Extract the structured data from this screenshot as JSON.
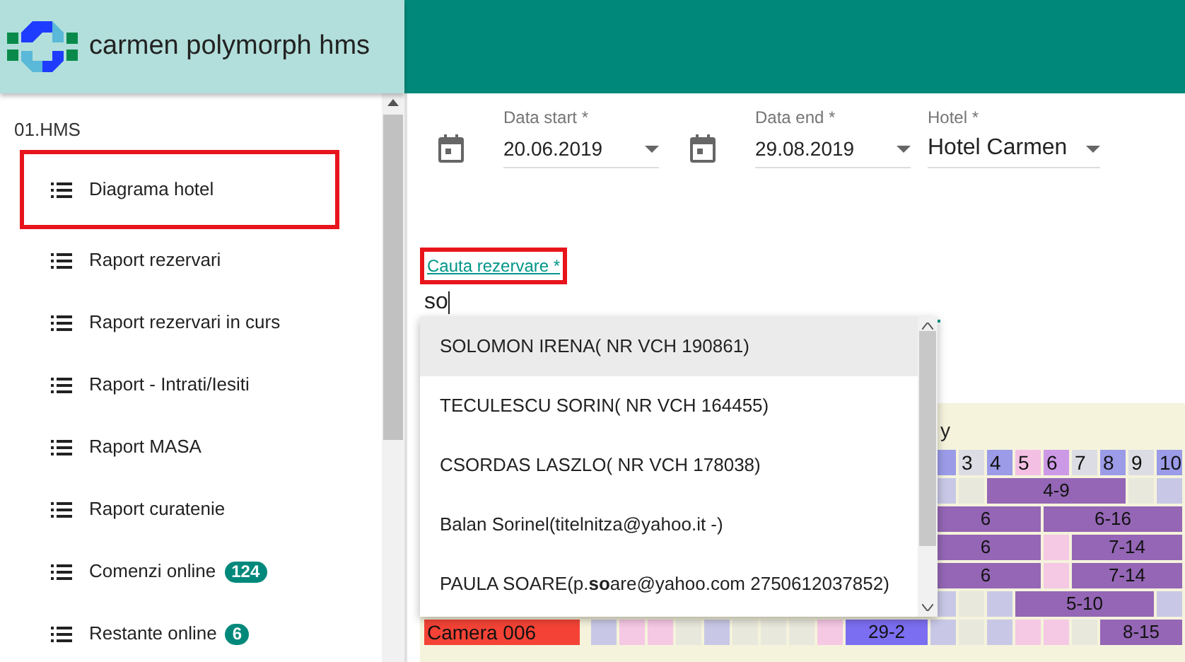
{
  "app": {
    "title": "carmen polymorph hms"
  },
  "sidebar": {
    "section": "01.HMS",
    "items": [
      {
        "label": "Diagrama hotel",
        "highlighted": true
      },
      {
        "label": "Raport rezervari",
        "highlighted": false
      },
      {
        "label": "Raport rezervari in curs",
        "highlighted": false
      },
      {
        "label": "Raport - Intrati/Iesiti",
        "highlighted": false
      },
      {
        "label": "Raport MASA",
        "highlighted": false
      },
      {
        "label": "Raport curatenie",
        "highlighted": false
      },
      {
        "label": "Comenzi online",
        "highlighted": false,
        "badge": "124"
      },
      {
        "label": "Restante online",
        "highlighted": false,
        "badge": "6"
      }
    ]
  },
  "filters": [
    {
      "kind": "date",
      "label": "Data start *",
      "value": "20.06.2019"
    },
    {
      "kind": "date",
      "label": "Data end *",
      "value": "29.08.2019"
    },
    {
      "kind": "select",
      "label": "Hotel *",
      "value": "Hotel Carmen"
    }
  ],
  "search": {
    "label": "Cauta rezervare *",
    "value": "so",
    "highlighted": true
  },
  "suggestions": [
    {
      "text": "SOLOMON IRENA( NR VCH 190861)",
      "selected": true
    },
    {
      "text": "TECULESCU SORIN( NR VCH 164455)",
      "selected": false
    },
    {
      "text": "CSORDAS LASZLO( NR VCH 178038)",
      "selected": false
    },
    {
      "text": "Balan Sorinel(titelnitza@yahoo.it -)",
      "selected": false
    },
    {
      "text": "PAULA SOARE(p.**so**are@yahoo.com 2750612037852)",
      "selected": false
    }
  ],
  "calendar": {
    "title": "y",
    "days": [
      {
        "color": "#9b9be8"
      },
      {
        "color": "#dcdce4",
        "label": "3"
      },
      {
        "color": "#9b9be8",
        "label": "4"
      },
      {
        "color": "#f3c0e3",
        "label": "5"
      },
      {
        "color": "#cc99e6",
        "label": "6"
      },
      {
        "color": "#dcdce4",
        "label": "7"
      },
      {
        "color": "#9b9be8",
        "label": "8"
      },
      {
        "color": "#dcdce4",
        "label": "9"
      },
      {
        "color": "#9b9be8",
        "label": "10"
      }
    ],
    "rows": [
      {
        "cells": [
          {
            "kind": "day",
            "color": "#c8c8e6"
          },
          {
            "kind": "day",
            "color": "#e8e8dc"
          },
          {
            "kind": "booking",
            "label": "4-9",
            "color": "#9466b5"
          },
          {
            "kind": "more"
          },
          {
            "kind": "more"
          },
          {
            "kind": "more"
          },
          {
            "kind": "more"
          },
          {
            "kind": "day",
            "color": "#e8e8dc"
          },
          {
            "kind": "day",
            "color": "#c8c8e6"
          }
        ]
      },
      {
        "cells": [
          {
            "kind": "booking",
            "label": "6",
            "color": "#9466b5"
          },
          {
            "kind": "more"
          },
          {
            "kind": "more"
          },
          {
            "kind": "more"
          },
          {
            "kind": "booking",
            "label": "6-16",
            "color": "#9466b5"
          },
          {
            "kind": "more"
          },
          {
            "kind": "more"
          },
          {
            "kind": "more"
          },
          {
            "kind": "more"
          }
        ]
      },
      {
        "cells": [
          {
            "kind": "booking",
            "label": "6",
            "color": "#9466b5"
          },
          {
            "kind": "more"
          },
          {
            "kind": "more"
          },
          {
            "kind": "more"
          },
          {
            "kind": "day",
            "color": "#f5c8e4"
          },
          {
            "kind": "booking",
            "label": "7-14",
            "color": "#9466b5"
          },
          {
            "kind": "more"
          },
          {
            "kind": "more"
          },
          {
            "kind": "more"
          }
        ]
      },
      {
        "cells": [
          {
            "kind": "booking",
            "label": "6",
            "color": "#9466b5"
          },
          {
            "kind": "more"
          },
          {
            "kind": "more"
          },
          {
            "kind": "more"
          },
          {
            "kind": "day",
            "color": "#f5c8e4"
          },
          {
            "kind": "booking",
            "label": "7-14",
            "color": "#9466b5"
          },
          {
            "kind": "more"
          },
          {
            "kind": "more"
          },
          {
            "kind": "more"
          }
        ]
      },
      {
        "cells": [
          {
            "kind": "day",
            "color": "#c8c8e6"
          },
          {
            "kind": "day",
            "color": "#e8e8dc"
          },
          {
            "kind": "day",
            "color": "#c8c8e6"
          },
          {
            "kind": "booking",
            "label": "5-10",
            "color": "#9466b5"
          },
          {
            "kind": "more"
          },
          {
            "kind": "more"
          },
          {
            "kind": "more"
          },
          {
            "kind": "more"
          },
          {
            "kind": "day",
            "color": "#c8c8e6"
          }
        ]
      },
      {
        "room": "Camera 006",
        "cells": [
          {
            "kind": "day",
            "color": "#c8c8e6"
          },
          {
            "kind": "day",
            "color": "#f5c8e4"
          },
          {
            "kind": "day",
            "color": "#f5c8e4"
          },
          {
            "kind": "day",
            "color": "#e8e8dc"
          },
          {
            "kind": "day",
            "color": "#c8c8e6"
          },
          {
            "kind": "day",
            "color": "#e8e8dc"
          },
          {
            "kind": "day",
            "color": "#e8e8dc"
          },
          {
            "kind": "day",
            "color": "#e8e8dc"
          },
          {
            "kind": "day",
            "color": "#f5c8e4"
          },
          {
            "kind": "booking",
            "label": "29-2",
            "color": "#7b6ef0"
          },
          {
            "kind": "more"
          },
          {
            "kind": "more"
          },
          {
            "kind": "day",
            "color": "#c8c8e6"
          },
          {
            "kind": "day",
            "color": "#e8e8dc"
          },
          {
            "kind": "day",
            "color": "#c8c8e6"
          },
          {
            "kind": "day",
            "color": "#f5c8e4"
          },
          {
            "kind": "day",
            "color": "#f5c8e4"
          },
          {
            "kind": "day",
            "color": "#e8e8dc"
          },
          {
            "kind": "booking",
            "label": "8-15",
            "color": "#9466b5"
          },
          {
            "kind": "more"
          },
          {
            "kind": "more"
          }
        ]
      }
    ]
  }
}
